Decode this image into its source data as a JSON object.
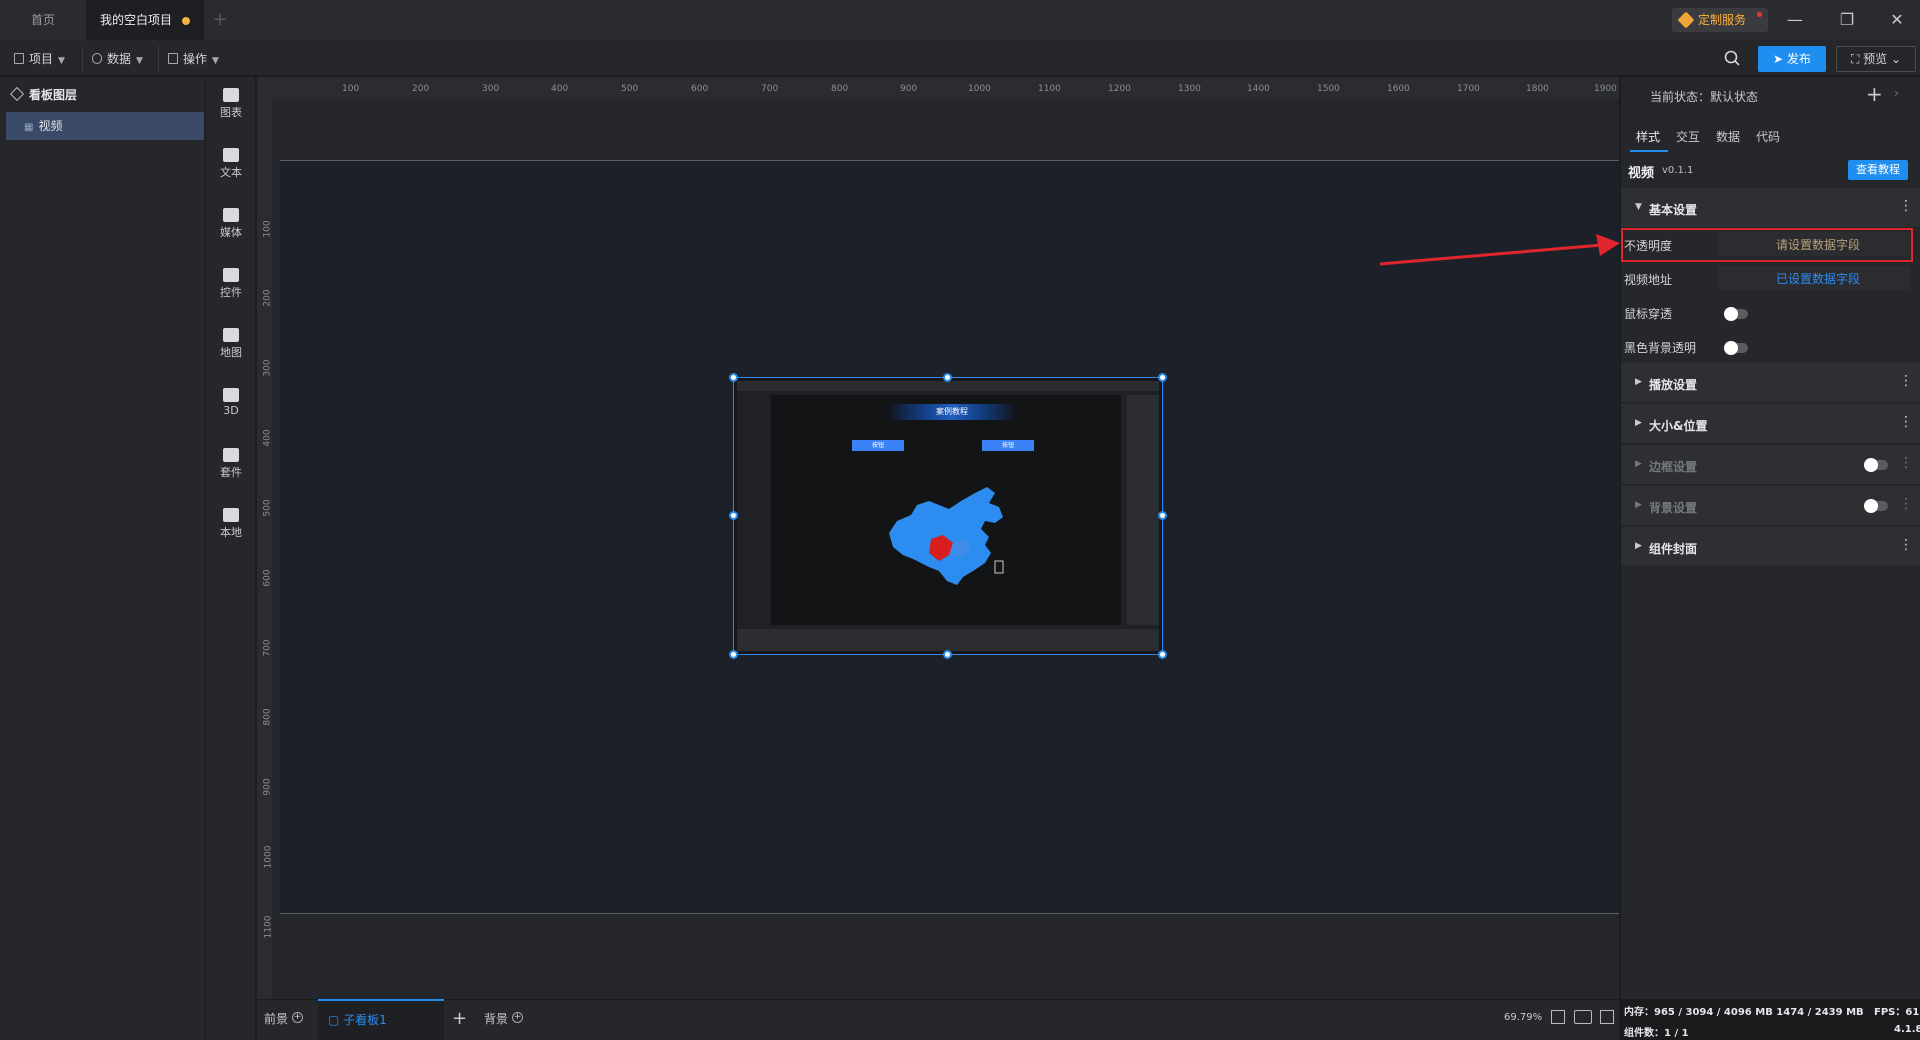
{
  "tabs": [
    {
      "label": "首页"
    },
    {
      "label": "我的空白项目"
    }
  ],
  "header": {
    "service_label": "定制服务",
    "window_controls": [
      "minimize-icon",
      "restore-icon",
      "close-icon"
    ]
  },
  "menu": {
    "project": "项目",
    "data": "数据",
    "ops": "操作",
    "publish": "发布",
    "preview": "预览"
  },
  "layers": {
    "title": "看板图层",
    "items": [
      {
        "label": "视频"
      }
    ]
  },
  "components": [
    {
      "label": "图表",
      "icon": "chart-icon"
    },
    {
      "label": "文本",
      "icon": "text-icon"
    },
    {
      "label": "媒体",
      "icon": "media-icon"
    },
    {
      "label": "控件",
      "icon": "widget-icon"
    },
    {
      "label": "地图",
      "icon": "map-icon"
    },
    {
      "label": "3D",
      "icon": "cube-icon"
    },
    {
      "label": "套件",
      "icon": "suite-icon"
    },
    {
      "label": "本地",
      "icon": "puzzle-icon"
    }
  ],
  "ruler": {
    "top": [
      "100",
      "200",
      "300",
      "400",
      "500",
      "600",
      "700",
      "800",
      "900",
      "1000",
      "1100",
      "1200",
      "1300",
      "1400",
      "1500",
      "1600",
      "1700",
      "1800",
      "1900"
    ],
    "left": [
      "100",
      "200",
      "300",
      "400",
      "500",
      "600",
      "700",
      "800",
      "900",
      "1000",
      "1100"
    ]
  },
  "thumb": {
    "banner": "案例教程",
    "btn1": "按钮",
    "btn2": "按钮"
  },
  "bottom": {
    "front": "前景",
    "sub": "子看板1",
    "bg": "背景",
    "zoom": "69.79%"
  },
  "panel": {
    "state": "当前状态：默认状态",
    "tabs": [
      "样式",
      "交互",
      "数据",
      "代码"
    ],
    "comp_name": "视频",
    "comp_ver": "v0.1.1",
    "tutorial": "查看教程",
    "sections": {
      "basic": "基本设置",
      "play": "播放设置",
      "size": "大小&位置",
      "border": "边框设置",
      "background": "背景设置",
      "cover": "组件封面"
    },
    "props": {
      "opacity_label": "不透明度",
      "opacity_hint": "请设置数据字段",
      "url_label": "视频地址",
      "url_hint": "已设置数据字段",
      "mouse_label": "鼠标穿透",
      "black_label": "黑色背景透明"
    }
  },
  "stats": {
    "mem": "内存：965 / 3094 / 4096 MB  1474 / 2439 MB",
    "fps": "FPS：61",
    "count": "组件数：1 / 1",
    "version": "4.1.8"
  },
  "colors": {
    "accent": "#1f8ef1",
    "highlight": "#e0262c",
    "map_fill": "#2d8cf0",
    "map_region": "#d81e1e"
  }
}
